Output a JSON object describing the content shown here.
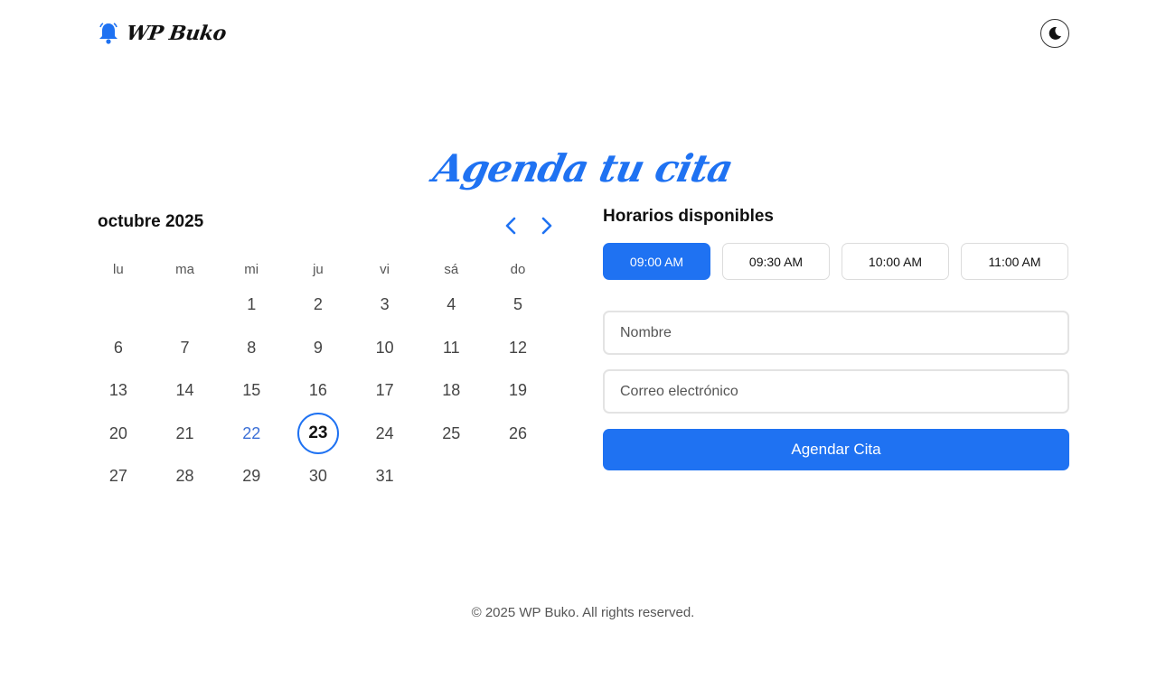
{
  "header": {
    "brand_name": "WP Buko",
    "brand_icon": "bell-icon",
    "theme_toggle_icon": "moon-icon"
  },
  "title": "Agenda tu cita",
  "calendar": {
    "month_label": "octubre 2025",
    "prev_icon": "chevron-left-icon",
    "next_icon": "chevron-right-icon",
    "weekdays": [
      "lu",
      "ma",
      "mi",
      "ju",
      "vi",
      "sá",
      "do"
    ],
    "leading_empty": 2,
    "days": [
      "1",
      "2",
      "3",
      "4",
      "5",
      "6",
      "7",
      "8",
      "9",
      "10",
      "11",
      "12",
      "13",
      "14",
      "15",
      "16",
      "17",
      "18",
      "19",
      "20",
      "21",
      "22",
      "23",
      "24",
      "25",
      "26",
      "27",
      "28",
      "29",
      "30",
      "31"
    ],
    "today": "22",
    "selected": "23"
  },
  "booking": {
    "title": "Horarios disponibles",
    "slots": [
      "09:00 AM",
      "09:30 AM",
      "10:00 AM",
      "11:00 AM"
    ],
    "active_slot": "09:00 AM",
    "name_placeholder": "Nombre",
    "email_placeholder": "Correo electrónico",
    "submit_label": "Agendar Cita"
  },
  "footer": {
    "text": "© 2025 WP Buko. All rights reserved."
  },
  "colors": {
    "accent": "#1f72f2",
    "today": "#3b6fd6"
  }
}
